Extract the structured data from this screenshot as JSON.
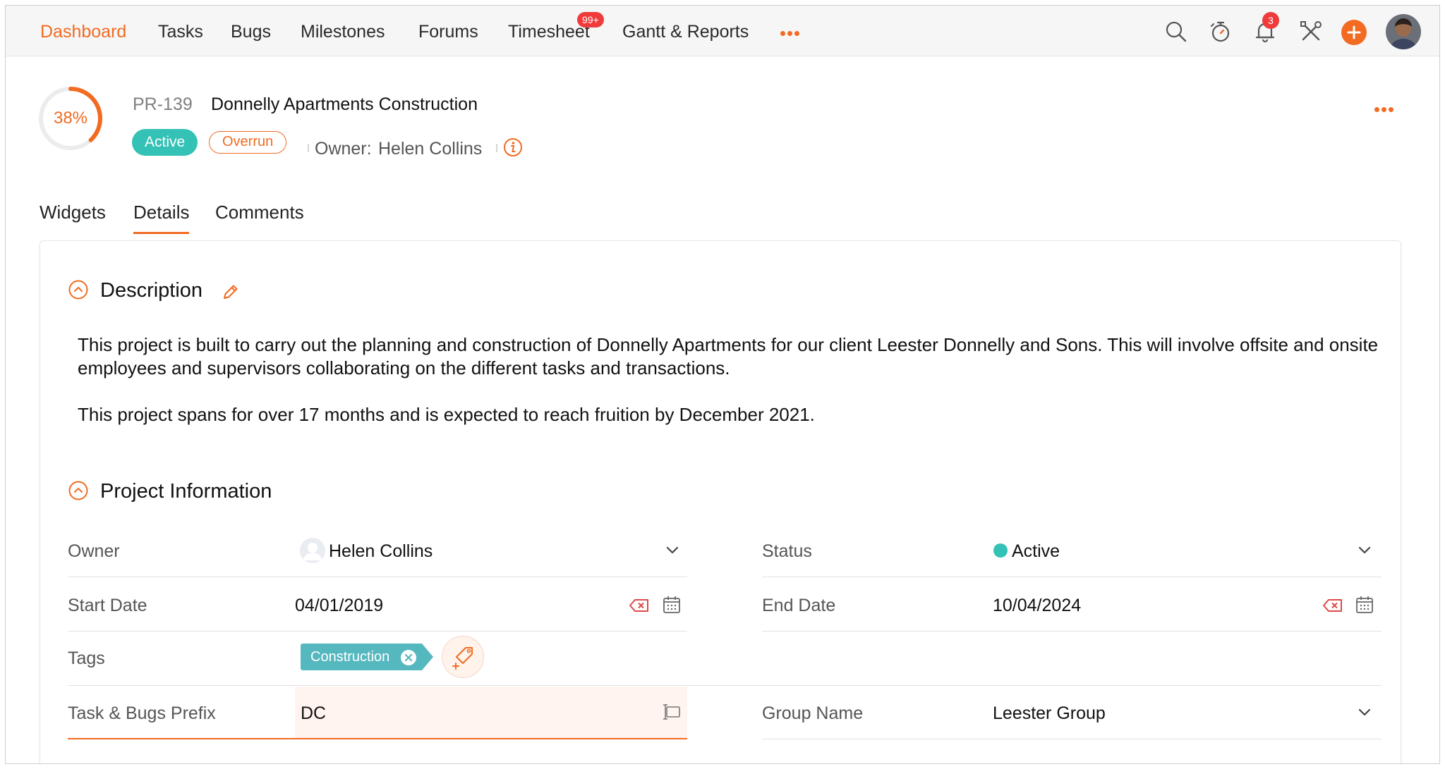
{
  "nav": {
    "items": [
      "Dashboard",
      "Tasks",
      "Bugs",
      "Milestones",
      "Forums",
      "Timesheet",
      "Gantt & Reports"
    ],
    "timesheet_badge": "99+",
    "notification_count": "3",
    "accent": "#f26b21"
  },
  "project": {
    "progress_label": "38%",
    "progress": 0.38,
    "id": "PR-139",
    "title": "Donnelly Apartments Construction",
    "status_badge": "Active",
    "overrun_badge": "Overrun",
    "owner_label": "Owner:",
    "owner_name": "Helen Collins"
  },
  "tabs": [
    "Widgets",
    "Details",
    "Comments"
  ],
  "active_tab": "Details",
  "description": {
    "title": "Description",
    "para1": "This project is built to carry out the planning and construction of Donnelly Apartments for our client Leester Donnelly and Sons. This will involve offsite and onsite employees and supervisors collaborating on the different tasks and transactions.",
    "para2": "This project spans for over 17 months and is expected to reach fruition by December 2021."
  },
  "info": {
    "title": "Project Information",
    "owner_label": "Owner",
    "owner_value": "Helen Collins",
    "status_label": "Status",
    "status_value": "Active",
    "start_label": "Start Date",
    "start_value": "04/01/2019",
    "end_label": "End Date",
    "end_value": "10/04/2024",
    "tags_label": "Tags",
    "tag": "Construction",
    "prefix_label": "Task & Bugs Prefix",
    "prefix_value": "DC",
    "group_label": "Group Name",
    "group_value": "Leester Group"
  },
  "icons": [
    "search-icon",
    "stopwatch-icon",
    "bell-icon",
    "tools-icon",
    "plus-icon",
    "info-icon",
    "pencil-icon",
    "chevron-up-icon",
    "chevron-down-icon",
    "clear-icon",
    "calendar-icon",
    "tag-add-icon"
  ]
}
